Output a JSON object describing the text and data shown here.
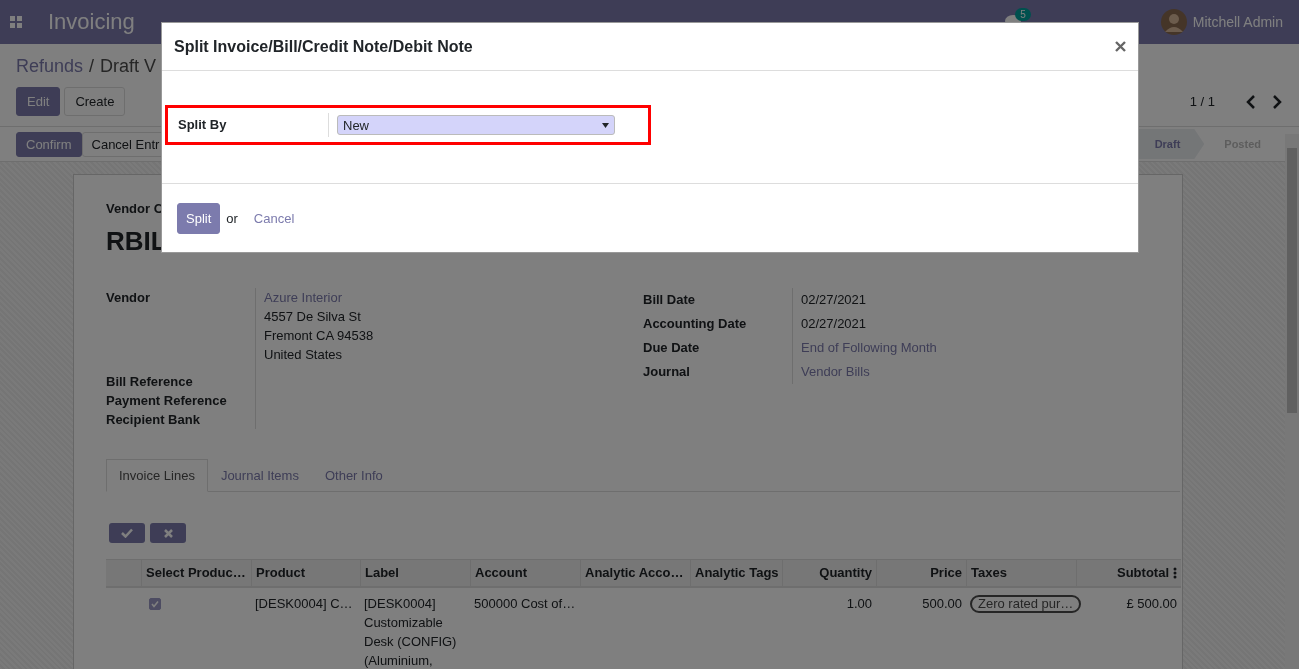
{
  "navbar": {
    "app_title": "Invoicing",
    "chat_badge": "5",
    "user": "Mitchell Admin"
  },
  "breadcrumb": {
    "parent": "Refunds",
    "separator": "/",
    "current": "Draft V"
  },
  "control_buttons": [
    {
      "label": "Edit",
      "kind": "primary"
    },
    {
      "label": "Create",
      "kind": "secondary"
    }
  ],
  "pager": "1 / 1",
  "status_buttons": [
    {
      "label": "Confirm",
      "kind": "primary"
    },
    {
      "label": "Cancel Entr",
      "kind": "secondary"
    }
  ],
  "statusbar": [
    {
      "label": "Draft",
      "selected": true
    },
    {
      "label": "Posted",
      "selected": false
    }
  ],
  "form": {
    "subtitle": "Vendor C",
    "name": "RBIL",
    "vendor": {
      "label": "Vendor",
      "link": "Azure Interior",
      "address": [
        "4557 De Silva St",
        "Fremont CA 94538",
        "United States"
      ]
    },
    "left_labels": [
      "Bill Reference",
      "Payment Reference",
      "Recipient Bank"
    ],
    "right_fields": [
      {
        "label": "Bill Date",
        "value": "02/27/2021",
        "kind": "text"
      },
      {
        "label": "Accounting Date",
        "value": "02/27/2021",
        "kind": "text"
      },
      {
        "label": "Due Date",
        "value": "End of Following Month",
        "kind": "link"
      },
      {
        "label": "Journal",
        "value": "Vendor Bills",
        "kind": "link"
      }
    ],
    "tabs": [
      {
        "label": "Invoice Lines",
        "selected": true
      },
      {
        "label": "Journal Items",
        "selected": false
      },
      {
        "label": "Other Info",
        "selected": false
      }
    ],
    "table": {
      "columns": [
        {
          "label": "Select Produc…",
          "kind": "text"
        },
        {
          "label": "Product",
          "kind": "text"
        },
        {
          "label": "Label",
          "kind": "text"
        },
        {
          "label": "Account",
          "kind": "text"
        },
        {
          "label": "Analytic Acco…",
          "kind": "text"
        },
        {
          "label": "Analytic Tags",
          "kind": "text"
        },
        {
          "label": "Quantity",
          "kind": "number"
        },
        {
          "label": "Price",
          "kind": "number"
        },
        {
          "label": "Taxes",
          "kind": "text"
        },
        {
          "label": "Subtotal",
          "kind": "number"
        }
      ],
      "rows": [
        {
          "checked": true,
          "product": "[DESK0004] C…",
          "label": "[DESK0004] Customizable Desk (CONFIG) (Aluminium,",
          "account": "500000 Cost of…",
          "quantity": "1.00",
          "price": "500.00",
          "taxes": "Zero rated pur…",
          "subtotal": "£ 500.00"
        }
      ]
    }
  },
  "dialog": {
    "title": "Split Invoice/Bill/Credit Note/Debit Note",
    "field_label": "Split By",
    "select_value": "New",
    "primary_button": "Split",
    "or_text": "or",
    "cancel_link": "Cancel"
  }
}
